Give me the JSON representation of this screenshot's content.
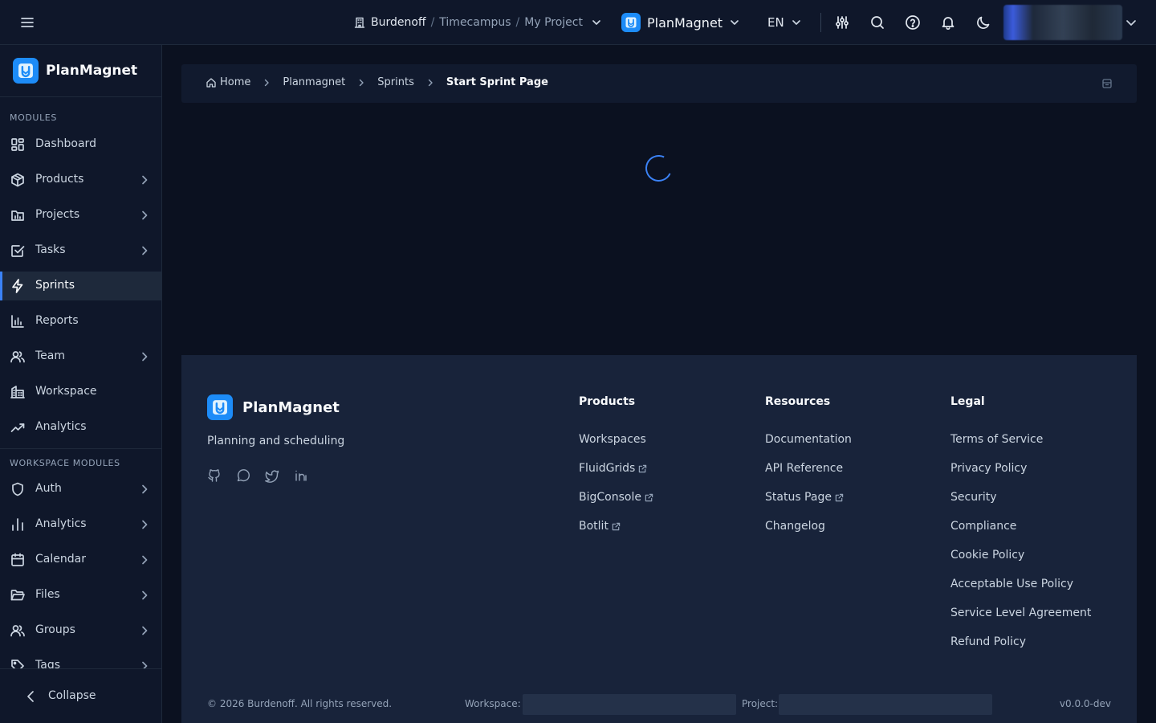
{
  "topbar": {
    "context": {
      "org": "Burdenoff",
      "workspace": "Timecampus",
      "project": "My Project"
    },
    "app_switcher": {
      "label": "PlanMagnet"
    },
    "language": "EN"
  },
  "sidebar": {
    "brand": "PlanMagnet",
    "section_modules": "MODULES",
    "modules": [
      {
        "label": "Dashboard",
        "icon": "dashboard-icon"
      },
      {
        "label": "Products",
        "icon": "box-icon"
      },
      {
        "label": "Projects",
        "icon": "project-icon"
      },
      {
        "label": "Tasks",
        "icon": "task-check-icon"
      },
      {
        "label": "Sprints",
        "icon": "lightning-icon"
      },
      {
        "label": "Reports",
        "icon": "bar-chart-icon"
      },
      {
        "label": "Team",
        "icon": "users-icon"
      },
      {
        "label": "Workspace",
        "icon": "building-icon"
      },
      {
        "label": "Analytics",
        "icon": "trend-icon"
      }
    ],
    "section_workspace": "WORKSPACE MODULES",
    "workspace_modules": [
      {
        "label": "Auth",
        "icon": "shield-icon"
      },
      {
        "label": "Analytics",
        "icon": "bar-chart-icon"
      },
      {
        "label": "Calendar",
        "icon": "calendar-icon"
      },
      {
        "label": "Files",
        "icon": "folder-icon"
      },
      {
        "label": "Groups",
        "icon": "users-icon"
      },
      {
        "label": "Tags",
        "icon": "tag-icon"
      }
    ],
    "collapse_label": "Collapse"
  },
  "breadcrumb": {
    "items": [
      "Home",
      "Planmagnet",
      "Sprints",
      "Start Sprint Page"
    ]
  },
  "footer": {
    "brand": "PlanMagnet",
    "tagline": "Planning and scheduling",
    "columns": [
      {
        "title": "Products",
        "links": [
          "Workspaces",
          "FluidGrids",
          "BigConsole",
          "Botlit"
        ]
      },
      {
        "title": "Resources",
        "links": [
          "Documentation",
          "API Reference",
          "Status Page",
          "Changelog"
        ]
      },
      {
        "title": "Legal",
        "links": [
          "Terms of Service",
          "Privacy Policy",
          "Security",
          "Compliance",
          "Cookie Policy",
          "Acceptable Use Policy",
          "Service Level Agreement",
          "Refund Policy"
        ]
      }
    ],
    "copyright": "© 2026 Burdenoff. All rights reserved.",
    "workspace_label": "Workspace:",
    "project_label": "Project:",
    "version": "v0.0.0-dev"
  },
  "colors": {
    "accent": "#3b82f6",
    "brand": "#1d8cf8",
    "bg": "#0b1120",
    "panel": "#0f172a",
    "footer": "#18233a"
  }
}
